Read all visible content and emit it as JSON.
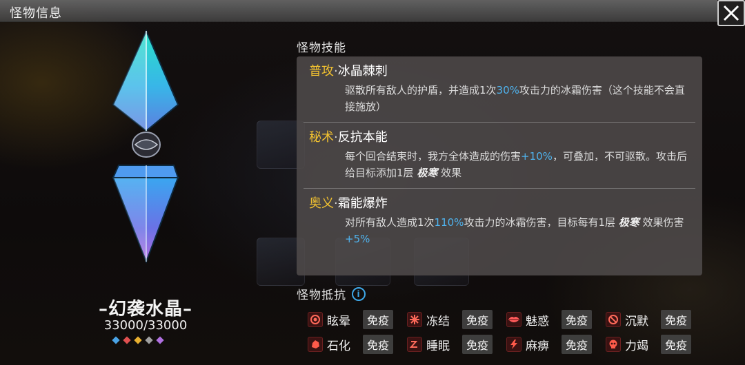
{
  "window": {
    "title": "怪物信息"
  },
  "monster": {
    "name": "–幻袭水晶–",
    "hp": "33000/33000",
    "gems": [
      "#4aa3e6",
      "#e05050",
      "#e8b030",
      "#a0a0a0",
      "#b070e0"
    ]
  },
  "skills": {
    "heading": "怪物技能",
    "list": [
      {
        "type": "普攻",
        "sep": "·",
        "name": "冰晶棘刺",
        "desc_parts": [
          {
            "t": "驱散所有敌人的护盾，并造成1次",
            "s": "n"
          },
          {
            "t": "30%",
            "s": "h"
          },
          {
            "t": "攻击力的冰霜伤害（这个技能不会直接施放）",
            "s": "n"
          }
        ]
      },
      {
        "type": "秘术",
        "sep": "·",
        "name": "反抗本能",
        "desc_parts": [
          {
            "t": "每个回合结束时，我方全体造成的伤害",
            "s": "n"
          },
          {
            "t": "+10%",
            "s": "h"
          },
          {
            "t": "，可叠加，不可驱散。攻击后给目标添加1层 ",
            "s": "n"
          },
          {
            "t": "极寒",
            "s": "w"
          },
          {
            "t": " 效果",
            "s": "n"
          }
        ]
      },
      {
        "type": "奥义",
        "sep": "·",
        "name": "霜能爆炸",
        "desc_parts": [
          {
            "t": "对所有敌人造成1次",
            "s": "n"
          },
          {
            "t": "110%",
            "s": "h"
          },
          {
            "t": "攻击力的冰霜伤害，目标每有1层 ",
            "s": "n"
          },
          {
            "t": "极寒",
            "s": "w"
          },
          {
            "t": " 效果伤害",
            "s": "n"
          },
          {
            "t": "+5%",
            "s": "h"
          }
        ]
      }
    ]
  },
  "resistances": {
    "heading": "怪物抵抗",
    "info_icon": "info-icon",
    "items": [
      {
        "name": "眩晕",
        "value": "免疫",
        "icon": "dizzy-icon"
      },
      {
        "name": "冻结",
        "value": "免疫",
        "icon": "freeze-icon"
      },
      {
        "name": "魅惑",
        "value": "免疫",
        "icon": "lips-icon"
      },
      {
        "name": "沉默",
        "value": "免疫",
        "icon": "silence-icon"
      },
      {
        "name": "石化",
        "value": "免疫",
        "icon": "petrify-icon"
      },
      {
        "name": "睡眠",
        "value": "免疫",
        "icon": "sleep-icon"
      },
      {
        "name": "麻痹",
        "value": "免疫",
        "icon": "lightning-icon"
      },
      {
        "name": "力竭",
        "value": "免疫",
        "icon": "skull-icon"
      }
    ]
  }
}
